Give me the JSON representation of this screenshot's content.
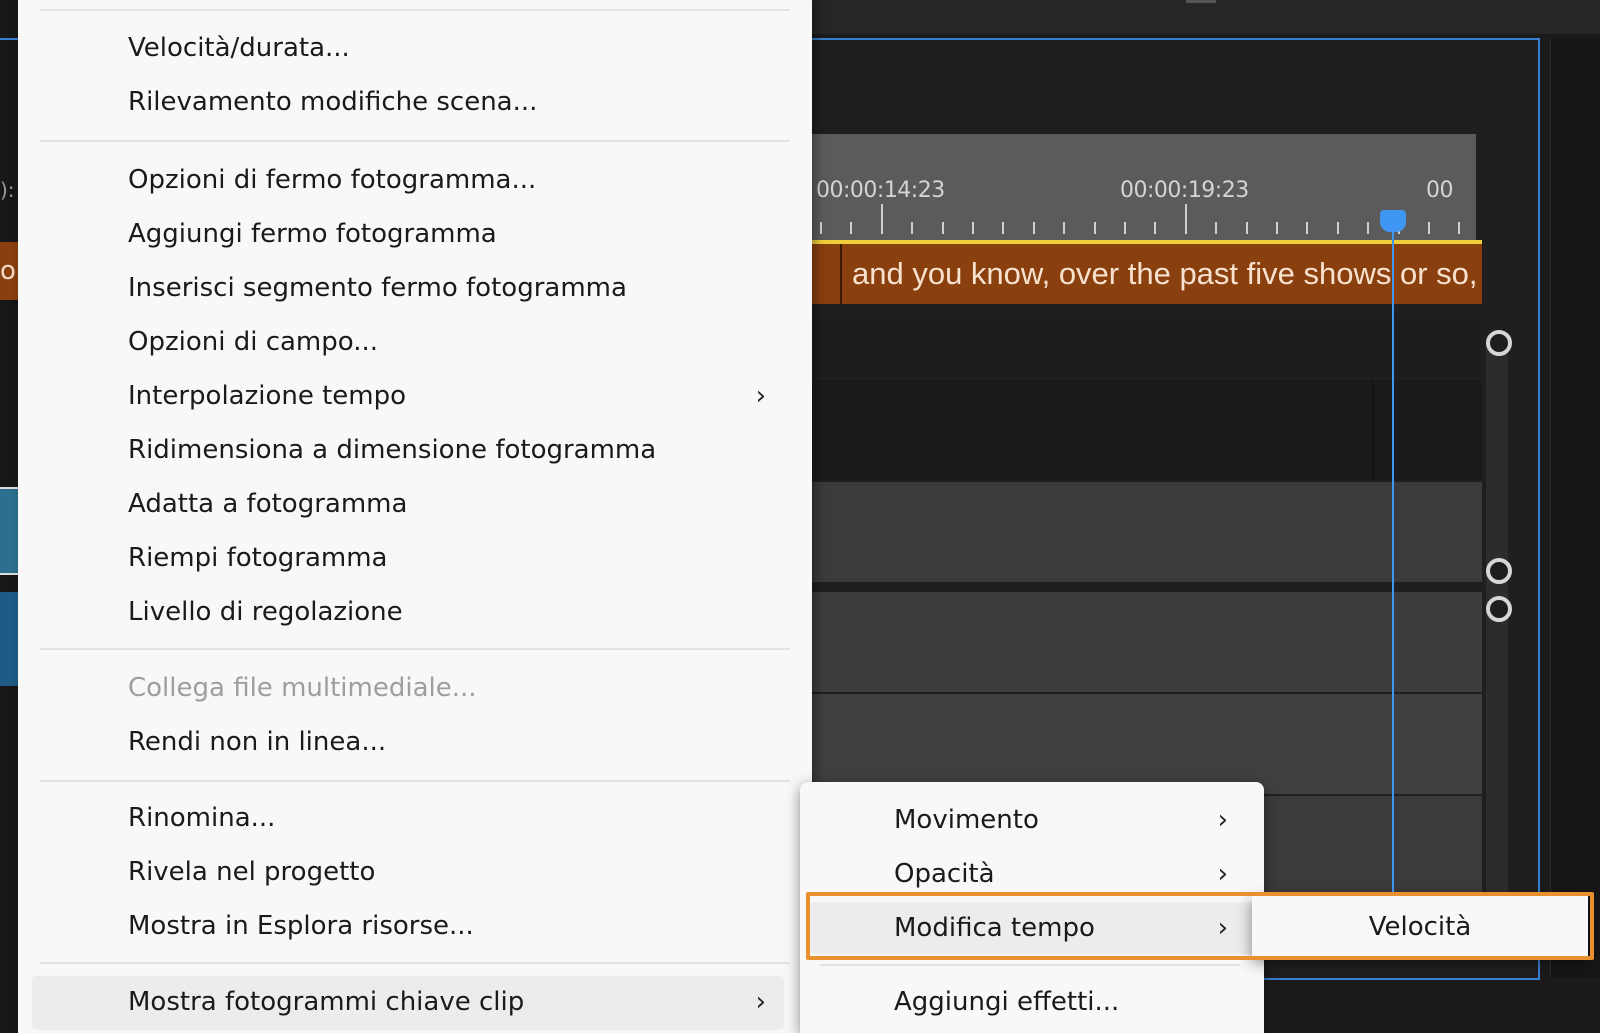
{
  "timeline": {
    "ruler_times": [
      "00:00:14:23",
      "00:00:19:23",
      "00"
    ],
    "left_time_fragment": "):",
    "left_caption_fragment": "o",
    "caption_text": "and you know, over the past five shows or so,",
    "playhead_color": "#3f96f3",
    "caption_color": "#8a3f0e",
    "panel_border_color": "#3a7fd0"
  },
  "context_menu": {
    "items": [
      {
        "label": "Velocità/durata..."
      },
      {
        "label": "Rilevamento modifiche scena..."
      },
      {
        "label": "Opzioni di fermo fotogramma..."
      },
      {
        "label": "Aggiungi fermo fotogramma"
      },
      {
        "label": "Inserisci segmento fermo fotogramma"
      },
      {
        "label": "Opzioni di campo..."
      },
      {
        "label": "Interpolazione tempo",
        "submenu": true
      },
      {
        "label": "Ridimensiona a dimensione fotogramma"
      },
      {
        "label": "Adatta a fotogramma"
      },
      {
        "label": "Riempi fotogramma"
      },
      {
        "label": "Livello di regolazione"
      },
      {
        "label": "Collega file multimediale...",
        "disabled": true
      },
      {
        "label": "Rendi non in linea..."
      },
      {
        "label": "Rinomina..."
      },
      {
        "label": "Rivela nel progetto"
      },
      {
        "label": "Mostra in Esplora risorse..."
      },
      {
        "label": "Mostra fotogrammi chiave clip",
        "submenu": true,
        "hovered": true
      }
    ]
  },
  "keyframes_submenu": {
    "items": [
      {
        "label": "Movimento",
        "submenu": true
      },
      {
        "label": "Opacità",
        "submenu": true
      },
      {
        "label": "Modifica tempo",
        "submenu": true,
        "hovered": true
      },
      {
        "label": "Aggiungi effetti..."
      }
    ]
  },
  "time_remap_submenu": {
    "items": [
      {
        "label": "Velocità"
      }
    ]
  },
  "highlight_color": "#e8912c"
}
